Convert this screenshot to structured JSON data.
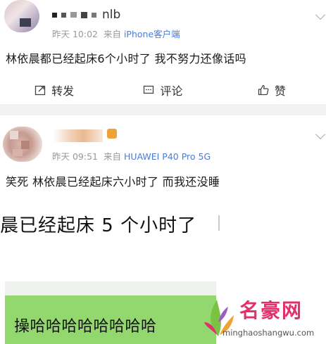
{
  "post1": {
    "name_suffix": "nlb",
    "time": "昨天 10:02",
    "source_prefix": "来自",
    "source": "iPhone客户端",
    "text": "林依晨都已经起床6个小时了 我不努力还像话吗"
  },
  "actions": {
    "repost": "转发",
    "comment": "评论",
    "like": "赞"
  },
  "post2": {
    "time": "昨天 09:51",
    "source_prefix": "来自",
    "source": "HUAWEI P40 Pro 5G",
    "text": "笑死 林依晨已经起床六小时了 而我还没睡"
  },
  "image_caption": "晨已经起床 5 个小时了",
  "green_caption": "操哈哈哈哈哈哈哈哈",
  "watermark": {
    "title": "名豪网",
    "url": "minghaoshangwu.com"
  },
  "colors": {
    "source_link": "#4a7bd8",
    "watermark": "#e2306c",
    "green_box": "#93d86f"
  }
}
